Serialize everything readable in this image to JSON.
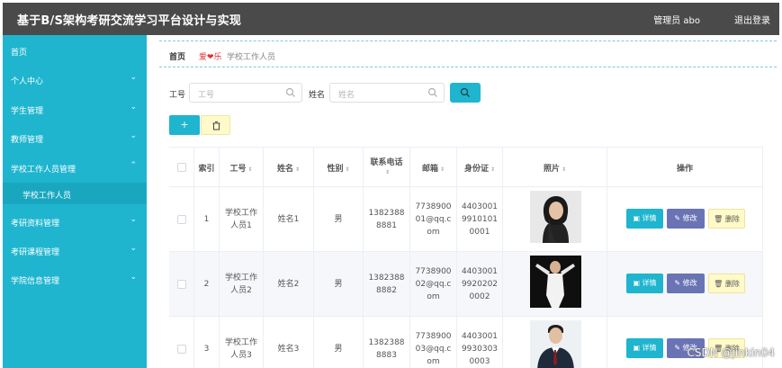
{
  "header": {
    "title": "基于B/S架构考研交流学习平台设计与实现",
    "user": "管理员 abo",
    "logout": "退出登录"
  },
  "sidebar": {
    "items": [
      {
        "label": "首页"
      },
      {
        "label": "个人中心"
      },
      {
        "label": "学生管理"
      },
      {
        "label": "教师管理"
      },
      {
        "label": "学校工作人员管理"
      },
      {
        "label": "学校工作人员"
      },
      {
        "label": "考研资料管理"
      },
      {
        "label": "考研课程管理"
      },
      {
        "label": "学院信息管理"
      }
    ]
  },
  "breadcrumb": {
    "home": "首页",
    "separator": "爱❤乐",
    "current": "学校工作人员"
  },
  "search": {
    "id_label": "工号",
    "id_placeholder": "工号",
    "name_label": "姓名",
    "name_placeholder": "姓名"
  },
  "actions": {
    "add_label": "+"
  },
  "table": {
    "columns": [
      "索引",
      "工号",
      "姓名",
      "性别",
      "联系电话",
      "邮箱",
      "身份证",
      "照片",
      "操作"
    ],
    "rows": [
      {
        "index": "1",
        "id": "学校工作人员1",
        "name": "姓名1",
        "gender": "男",
        "phone": "13823888881",
        "email": "773890001@qq.com",
        "idcard": "440300199101010001"
      },
      {
        "index": "2",
        "id": "学校工作人员2",
        "name": "姓名2",
        "gender": "男",
        "phone": "13823888882",
        "email": "773890002@qq.com",
        "idcard": "440300199202020002"
      },
      {
        "index": "3",
        "id": "学校工作人员3",
        "name": "姓名3",
        "gender": "男",
        "phone": "13823888883",
        "email": "773890003@qq.com",
        "idcard": "440300199303030003"
      }
    ],
    "buttons": {
      "detail": "详情",
      "edit": "修改",
      "delete": "删除"
    }
  },
  "watermark": "CSDN @jinkin04",
  "colors": {
    "accent": "#1fb5cf",
    "header": "#4a4a4a",
    "edit": "#6a74b4",
    "delete": "#fffac8"
  }
}
